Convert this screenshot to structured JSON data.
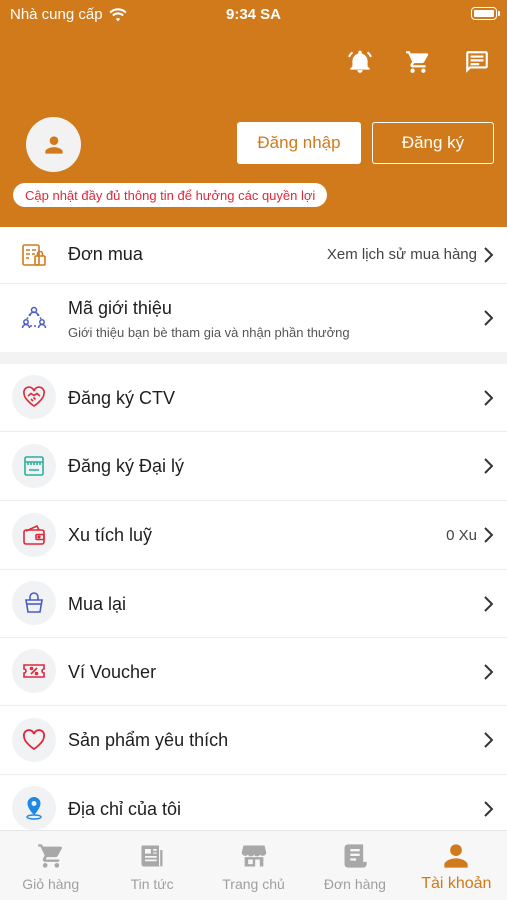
{
  "status_bar": {
    "carrier": "Nhà cung cấp",
    "time": "9:34 SA"
  },
  "header": {
    "icons": [
      "bell-icon",
      "cart-icon",
      "message-icon"
    ],
    "login_label": "Đăng nhập",
    "register_label": "Đăng ký",
    "promo_text": "Cập nhật đầy đủ thông tin để hưởng các quyền lợi"
  },
  "menu": {
    "orders": {
      "label": "Đơn mua",
      "right": "Xem lịch sử mua hàng"
    },
    "referral": {
      "label": "Mã giới thiệu",
      "sub": "Giới thiệu bạn bè tham gia và nhận phần thưởng"
    },
    "items": [
      {
        "label": "Đăng ký CTV",
        "icon": "heart-handshake-icon",
        "right": ""
      },
      {
        "label": "Đăng ký Đại lý",
        "icon": "store-icon",
        "right": ""
      },
      {
        "label": "Xu tích luỹ",
        "icon": "wallet-icon",
        "right": "0 Xu"
      },
      {
        "label": "Mua lại",
        "icon": "bag-icon",
        "right": ""
      },
      {
        "label": "Ví Voucher",
        "icon": "voucher-icon",
        "right": ""
      },
      {
        "label": "Sản phẩm yêu thích",
        "icon": "heart-icon",
        "right": ""
      },
      {
        "label": "Địa chỉ của tôi",
        "icon": "location-pin-icon",
        "right": ""
      }
    ]
  },
  "tabbar": {
    "tabs": [
      {
        "label": "Giỏ hàng",
        "icon": "cart-icon"
      },
      {
        "label": "Tin tức",
        "icon": "news-icon"
      },
      {
        "label": "Trang chủ",
        "icon": "shop-icon"
      },
      {
        "label": "Đơn hàng",
        "icon": "receipt-icon"
      },
      {
        "label": "Tài khoản",
        "icon": "user-icon"
      }
    ],
    "active": "Tài khoản"
  },
  "colors": {
    "brand": "#D07A1B",
    "promo_text": "#E0283A"
  }
}
